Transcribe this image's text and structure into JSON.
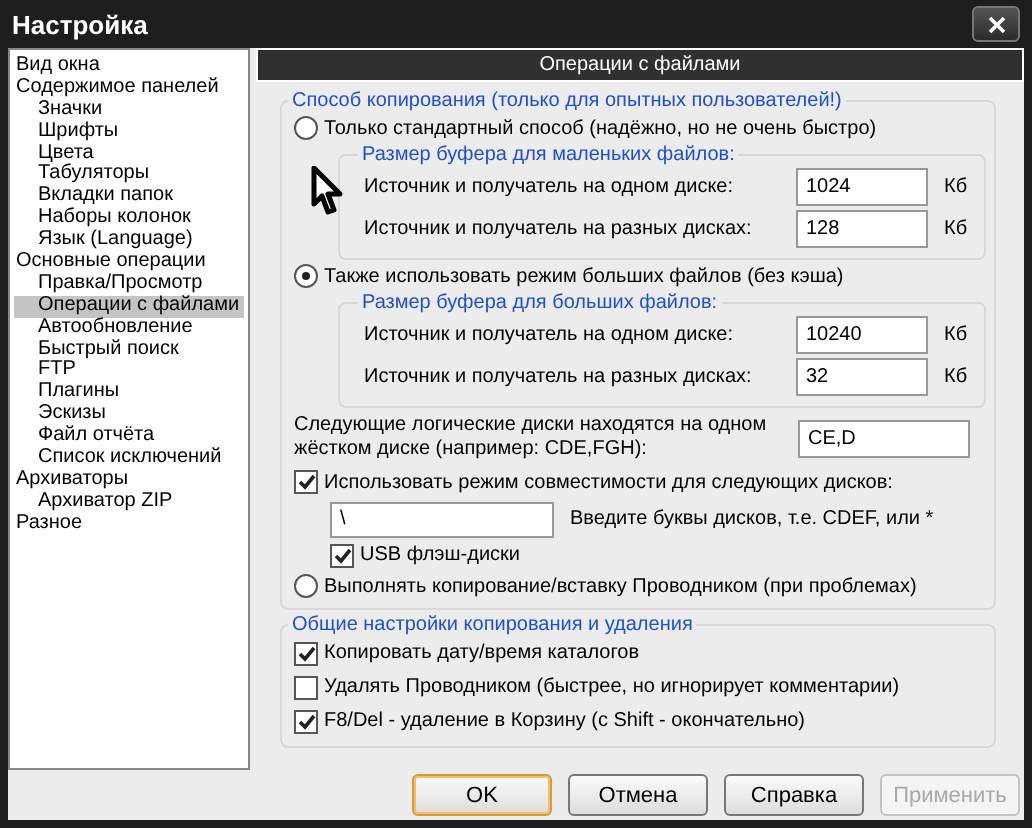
{
  "window": {
    "title": "Настройка"
  },
  "sidebar": {
    "items": [
      {
        "label": "Вид окна",
        "selected": false
      },
      {
        "label": "Содержимое панелей",
        "selected": false,
        "children": [
          {
            "label": "Значки",
            "selected": false
          },
          {
            "label": "Шрифты",
            "selected": false
          },
          {
            "label": "Цвета",
            "selected": false
          },
          {
            "label": "Табуляторы",
            "selected": false
          },
          {
            "label": "Вкладки папок",
            "selected": false
          },
          {
            "label": "Наборы колонок",
            "selected": false
          },
          {
            "label": "Язык (Language)",
            "selected": false
          }
        ]
      },
      {
        "label": "Основные операции",
        "selected": false,
        "children": [
          {
            "label": "Правка/Просмотр",
            "selected": false
          },
          {
            "label": "Операции с файлами",
            "selected": true
          },
          {
            "label": "Автообновление",
            "selected": false
          },
          {
            "label": "Быстрый поиск",
            "selected": false
          },
          {
            "label": "FTP",
            "selected": false
          },
          {
            "label": "Плагины",
            "selected": false
          },
          {
            "label": "Эскизы",
            "selected": false
          },
          {
            "label": "Файл отчёта",
            "selected": false
          },
          {
            "label": "Список исключений",
            "selected": false
          }
        ]
      },
      {
        "label": "Архиваторы",
        "selected": false,
        "children": [
          {
            "label": "Архиватор ZIP",
            "selected": false
          }
        ]
      },
      {
        "label": "Разное",
        "selected": false
      }
    ]
  },
  "panel": {
    "title": "Операции с файлами",
    "copy_group": {
      "legend": "Способ копирования (только для опытных пользователей!)",
      "items": [
        {
          "kind": "radio",
          "label": "Только стандартный способ (надёжно, но не очень быстро)",
          "selected": false
        },
        {
          "kind": "buffer_group",
          "legend": "Размер буфера для маленьких файлов:",
          "rows": [
            {
              "label": "Источник и получатель на одном диске:",
              "value": "1024",
              "unit": "Кб"
            },
            {
              "label": "Источник и получатель на разных дисках:",
              "value": "128",
              "unit": "Кб"
            }
          ]
        },
        {
          "kind": "radio",
          "label": "Также использовать режим больших файлов (без кэша)",
          "selected": true
        },
        {
          "kind": "buffer_group",
          "legend": "Размер буфера для больших файлов:",
          "rows": [
            {
              "label": "Источник и получатель на одном диске:",
              "value": "10240",
              "unit": "Кб"
            },
            {
              "label": "Источник и получатель на разных дисках:",
              "value": "32",
              "unit": "Кб"
            }
          ]
        },
        {
          "kind": "field_row",
          "label": "Следующие логические диски находятся на одном жёстком диске (например: CDE,FGH):",
          "value": "CE,D"
        },
        {
          "kind": "checkbox",
          "label": "Использовать режим совместимости для следующих дисков:",
          "checked": true,
          "children": [
            {
              "kind": "input_row",
              "value": "\\",
              "hint": "Введите буквы дисков, т.е. CDEF, или *"
            },
            {
              "kind": "checkbox",
              "label": "USB флэш-диски",
              "checked": true
            }
          ]
        },
        {
          "kind": "radio",
          "label": "Выполнять копирование/вставку Проводником (при проблемах)",
          "selected": false
        }
      ]
    },
    "general_group": {
      "legend": "Общие настройки копирования и удаления",
      "checkboxes": [
        {
          "label": "Копировать дату/время каталогов",
          "checked": true
        },
        {
          "label": "Удалять Проводником (быстрее, но игнорирует комментарии)",
          "checked": false
        },
        {
          "label": "F8/Del - удаление в Корзину (с Shift - окончательно)",
          "checked": true
        }
      ]
    }
  },
  "buttons": [
    {
      "label": "OK",
      "default": true,
      "disabled": false
    },
    {
      "label": "Отмена",
      "default": false,
      "disabled": false
    },
    {
      "label": "Справка",
      "default": false,
      "disabled": false
    },
    {
      "label": "Применить",
      "default": false,
      "disabled": true
    }
  ]
}
